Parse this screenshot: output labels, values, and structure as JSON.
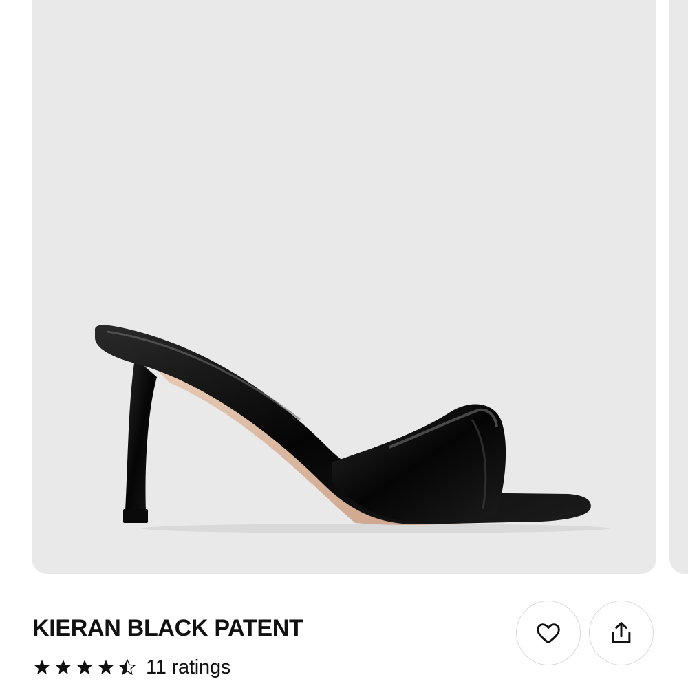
{
  "product": {
    "name": "KIERAN BLACK PATENT",
    "rating": 4.5,
    "rating_max": 5,
    "rating_count_text": "11 ratings",
    "image_icon": "black-patent-mule-heel-image"
  },
  "actions": {
    "favorite_icon": "heart-icon",
    "share_icon": "share-icon"
  },
  "colors": {
    "image_background": "#e9e9ea",
    "text": "#111111",
    "button_border": "#dadada"
  }
}
